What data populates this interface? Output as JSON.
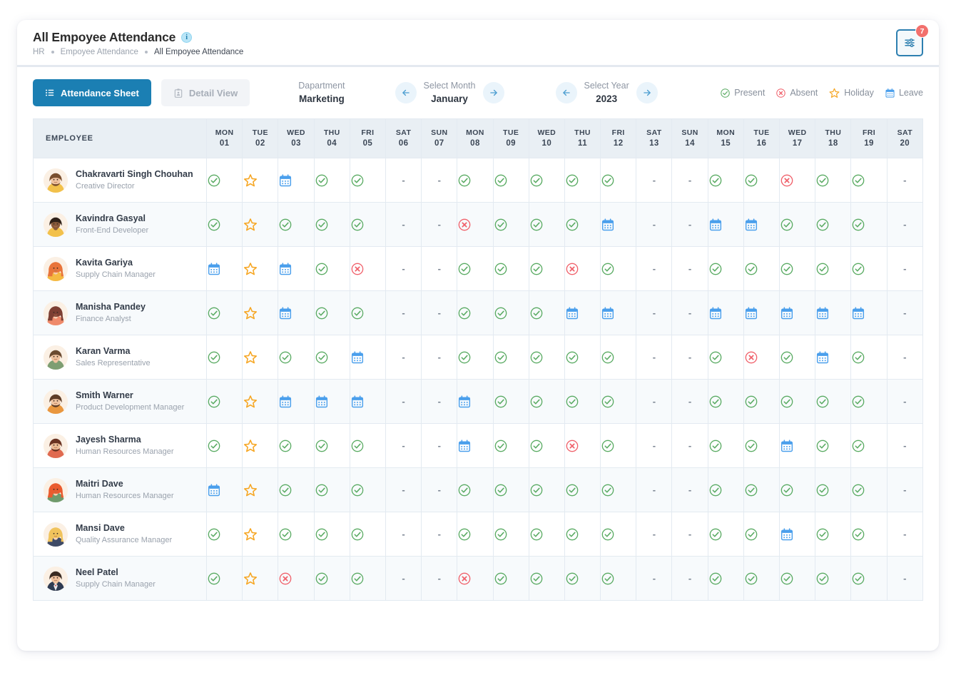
{
  "header": {
    "title": "All Empoyee Attendance",
    "info_icon": "info-icon",
    "breadcrumb": [
      "HR",
      "Empoyee Attendance",
      "All Empoyee Attendance"
    ],
    "filter_icon": "sliders-icon",
    "filter_badge": "7"
  },
  "toolbar": {
    "attendance_sheet_label": "Attendance Sheet",
    "attendance_sheet_icon": "list-icon",
    "detail_view_label": "Detail View",
    "detail_view_icon": "clipboard-icon",
    "department_label": "Dapartment",
    "department_value": "Marketing",
    "month_label": "Select Month",
    "month_value": "January",
    "year_label": "Select Year",
    "year_value": "2023",
    "prev_icon": "arrow-left-icon",
    "next_icon": "arrow-right-icon",
    "legend": [
      {
        "key": "present",
        "label": "Present",
        "icon": "check-circle-icon",
        "color": "#57b45f"
      },
      {
        "key": "absent",
        "label": "Absent",
        "icon": "x-circle-icon",
        "color": "#f0616b"
      },
      {
        "key": "holiday",
        "label": "Holiday",
        "icon": "star-icon",
        "color": "#f6a623"
      },
      {
        "key": "leave",
        "label": "Leave",
        "icon": "calendar-icon",
        "color": "#4a9fec"
      }
    ]
  },
  "table": {
    "employee_header": "EMPLOYEE",
    "days": [
      {
        "dow": "MON",
        "num": "01"
      },
      {
        "dow": "TUE",
        "num": "02"
      },
      {
        "dow": "WED",
        "num": "03"
      },
      {
        "dow": "THU",
        "num": "04"
      },
      {
        "dow": "FRI",
        "num": "05"
      },
      {
        "dow": "SAT",
        "num": "06"
      },
      {
        "dow": "SUN",
        "num": "07"
      },
      {
        "dow": "MON",
        "num": "08"
      },
      {
        "dow": "TUE",
        "num": "09"
      },
      {
        "dow": "WED",
        "num": "10"
      },
      {
        "dow": "THU",
        "num": "11"
      },
      {
        "dow": "FRI",
        "num": "12"
      },
      {
        "dow": "SAT",
        "num": "13"
      },
      {
        "dow": "SUN",
        "num": "14"
      },
      {
        "dow": "MON",
        "num": "15"
      },
      {
        "dow": "TUE",
        "num": "16"
      },
      {
        "dow": "WED",
        "num": "17"
      },
      {
        "dow": "THU",
        "num": "18"
      },
      {
        "dow": "FRI",
        "num": "19"
      },
      {
        "dow": "SAT",
        "num": "20"
      }
    ],
    "rows": [
      {
        "name": "Chakravarti Singh Chouhan",
        "role": "Creative Director",
        "avatar": "avatar-bearded-man-yellow",
        "status": [
          "P",
          "H",
          "L",
          "P",
          "P",
          "-",
          "-",
          "P",
          "P",
          "P",
          "P",
          "P",
          "-",
          "-",
          "P",
          "P",
          "A",
          "P",
          "P",
          "-"
        ]
      },
      {
        "name": "Kavindra Gasyal",
        "role": "Front-End Developer",
        "avatar": "avatar-dark-man-yellow",
        "status": [
          "P",
          "H",
          "P",
          "P",
          "P",
          "-",
          "-",
          "A",
          "P",
          "P",
          "P",
          "L",
          "-",
          "-",
          "L",
          "L",
          "P",
          "P",
          "P",
          "-"
        ]
      },
      {
        "name": "Kavita Gariya",
        "role": "Supply Chain Manager",
        "avatar": "avatar-redhair-woman",
        "status": [
          "L",
          "H",
          "L",
          "P",
          "A",
          "-",
          "-",
          "P",
          "P",
          "P",
          "A",
          "P",
          "-",
          "-",
          "P",
          "P",
          "P",
          "P",
          "P",
          "-"
        ]
      },
      {
        "name": "Manisha Pandey",
        "role": "Finance Analyst",
        "avatar": "avatar-short-hair-woman",
        "status": [
          "P",
          "H",
          "L",
          "P",
          "P",
          "-",
          "-",
          "P",
          "P",
          "P",
          "L",
          "L",
          "-",
          "-",
          "L",
          "L",
          "L",
          "L",
          "L",
          "-"
        ]
      },
      {
        "name": "Karan Varma",
        "role": "Sales Representative",
        "avatar": "avatar-green-shirt-man",
        "status": [
          "P",
          "H",
          "P",
          "P",
          "L",
          "-",
          "-",
          "P",
          "P",
          "P",
          "P",
          "P",
          "-",
          "-",
          "P",
          "A",
          "P",
          "L",
          "P",
          "-"
        ]
      },
      {
        "name": "Smith Warner",
        "role": "Product Development Manager",
        "avatar": "avatar-beard-orange-man",
        "status": [
          "P",
          "H",
          "L",
          "L",
          "L",
          "-",
          "-",
          "L",
          "P",
          "P",
          "P",
          "P",
          "-",
          "-",
          "P",
          "P",
          "P",
          "P",
          "P",
          "-"
        ]
      },
      {
        "name": "Jayesh Sharma",
        "role": "Human Resources Manager",
        "avatar": "avatar-beard-red-man",
        "status": [
          "P",
          "H",
          "P",
          "P",
          "P",
          "-",
          "-",
          "L",
          "P",
          "P",
          "A",
          "P",
          "-",
          "-",
          "P",
          "P",
          "L",
          "P",
          "P",
          "-"
        ]
      },
      {
        "name": "Maitri Dave",
        "role": "Human Resources Manager",
        "avatar": "avatar-redhair-green-woman",
        "status": [
          "L",
          "H",
          "P",
          "P",
          "P",
          "-",
          "-",
          "P",
          "P",
          "P",
          "P",
          "P",
          "-",
          "-",
          "P",
          "P",
          "P",
          "P",
          "P",
          "-"
        ]
      },
      {
        "name": "Mansi Dave",
        "role": "Quality Assurance Manager",
        "avatar": "avatar-blonde-woman",
        "status": [
          "P",
          "H",
          "P",
          "P",
          "P",
          "-",
          "-",
          "P",
          "P",
          "P",
          "P",
          "P",
          "-",
          "-",
          "P",
          "P",
          "L",
          "P",
          "P",
          "-"
        ]
      },
      {
        "name": "Neel Patel",
        "role": "Supply Chain Manager",
        "avatar": "avatar-suit-man",
        "status": [
          "P",
          "H",
          "A",
          "P",
          "P",
          "-",
          "-",
          "A",
          "P",
          "P",
          "P",
          "P",
          "-",
          "-",
          "P",
          "P",
          "P",
          "P",
          "P",
          "-"
        ]
      }
    ]
  }
}
